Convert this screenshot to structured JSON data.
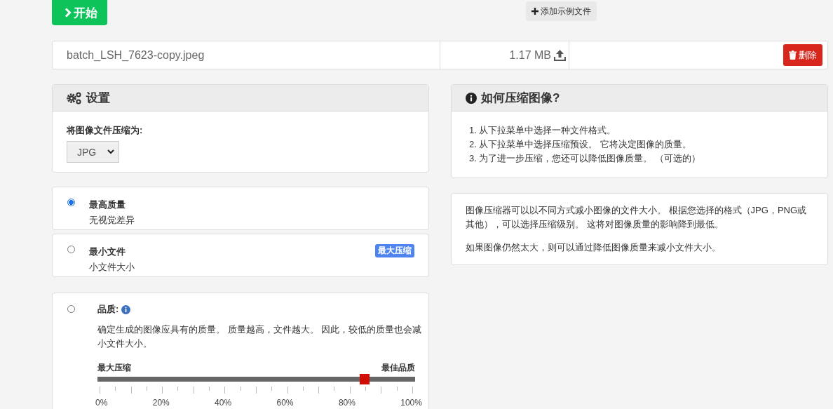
{
  "start_button": {
    "label": "开始"
  },
  "add_sample_button": {
    "label": "添加示例文件"
  },
  "file": {
    "name": "batch_LSH_7623-copy.jpeg",
    "size": "1.17 MB",
    "delete_label": "删除"
  },
  "settings": {
    "title": "设置",
    "format_label": "将图像文件压缩为:",
    "format": "JPG"
  },
  "presets": [
    {
      "title": "最高质量",
      "subtitle": "无视觉差异",
      "selected": true
    },
    {
      "title": "最小文件",
      "subtitle": "小文件大小",
      "selected": false,
      "badge": "最大压缩"
    }
  ],
  "quality": {
    "selected": false,
    "title": "品质:",
    "description": "确定生成的图像应具有的质量。 质量越高，文件越大。 因此，较低的质量也会减小文件大小。",
    "min_label": "最大压缩",
    "max_label": "最佳品质",
    "level": 0.84,
    "tick_labels": [
      "0%",
      "20%",
      "40%",
      "60%",
      "80%",
      "100%"
    ]
  },
  "howto": {
    "title": "如何压缩图像?",
    "steps": [
      "1. 从下拉菜单中选择一种文件格式。",
      "2. 从下拉菜单中选择压缩预设。 它将决定图像的质量。",
      "3. 为了进一步压缩，您还可以降低图像质量。 （可选的）"
    ]
  },
  "about": {
    "paragraphs": [
      "图像压缩器可以以不同方式减小图像的文件大小。 根据您选择的格式（JPG，PNG或其他），可以选择压缩级别。 这将对图像质量的影响降到最低。",
      "如果图像仍然太大，则可以通过降低图像质量来减小文件大小。"
    ]
  }
}
